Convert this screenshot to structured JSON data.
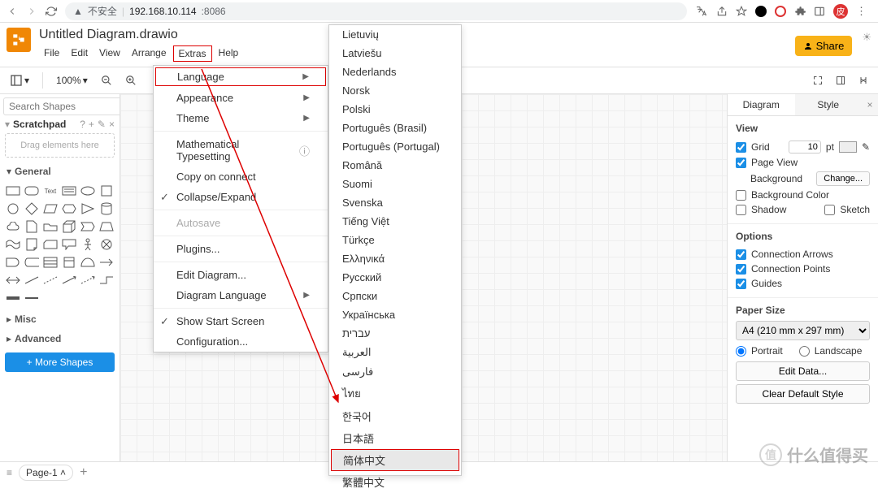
{
  "browser": {
    "insecure_label": "不安全",
    "host": "192.168.10.114",
    "port": ":8086",
    "avatar_char": "皮"
  },
  "header": {
    "doc_title": "Untitled Diagram.drawio",
    "menus": [
      "File",
      "Edit",
      "View",
      "Arrange",
      "Extras",
      "Help"
    ],
    "share_label": "Share"
  },
  "toolbar": {
    "zoom": "100%"
  },
  "left": {
    "search_placeholder": "Search Shapes",
    "scratchpad": "Scratchpad",
    "drag_hint": "Drag elements here",
    "sections": {
      "general": "General",
      "misc": "Misc",
      "advanced": "Advanced"
    },
    "more_shapes": "+ More Shapes"
  },
  "extras_menu": {
    "language": "Language",
    "appearance": "Appearance",
    "theme": "Theme",
    "math": "Mathematical Typesetting",
    "copy_connect": "Copy on connect",
    "collapse": "Collapse/Expand",
    "autosave": "Autosave",
    "plugins": "Plugins...",
    "edit_diagram": "Edit Diagram...",
    "diagram_lang": "Diagram Language",
    "show_start": "Show Start Screen",
    "config": "Configuration..."
  },
  "lang_menu": [
    "Lietuvių",
    "Latviešu",
    "Nederlands",
    "Norsk",
    "Polski",
    "Português (Brasil)",
    "Português (Portugal)",
    "Română",
    "Suomi",
    "Svenska",
    "Tiếng Việt",
    "Türkçe",
    "Ελληνικά",
    "Русский",
    "Српски",
    "Українська",
    "עברית",
    "العربية",
    "فارسی",
    "ไทย",
    "한국어",
    "日本語",
    "简体中文",
    "繁體中文"
  ],
  "lang_selected_index": 22,
  "right": {
    "tab_diagram": "Diagram",
    "tab_style": "Style",
    "view": "View",
    "grid": "Grid",
    "grid_val": "10",
    "grid_unit": "pt",
    "page_view": "Page View",
    "background": "Background",
    "change": "Change...",
    "bg_color": "Background Color",
    "shadow": "Shadow",
    "sketch": "Sketch",
    "options": "Options",
    "conn_arrows": "Connection Arrows",
    "conn_points": "Connection Points",
    "guides": "Guides",
    "paper_size": "Paper Size",
    "paper_sel": "A4 (210 mm x 297 mm)",
    "portrait": "Portrait",
    "landscape": "Landscape",
    "edit_data": "Edit Data...",
    "clear_style": "Clear Default Style"
  },
  "footer": {
    "page": "Page-1"
  },
  "watermark": "什么值得买"
}
